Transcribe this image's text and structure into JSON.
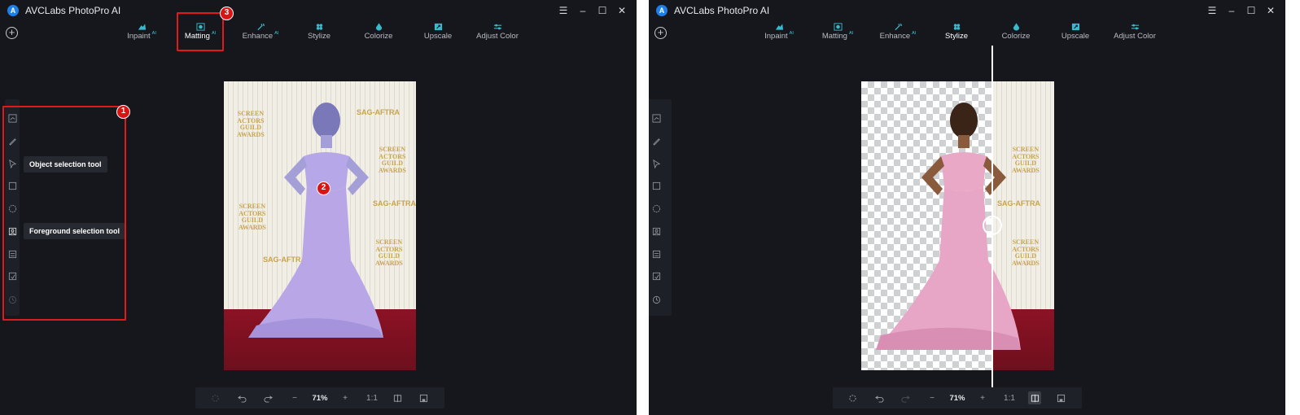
{
  "app": {
    "title": "AVCLabs PhotoPro AI",
    "logo_letter": "A"
  },
  "window_controls": {
    "menu": "☰",
    "minimize": "–",
    "maximize": "☐",
    "close": "✕"
  },
  "toolbar": {
    "add_label": "+",
    "ai_tag": "AI",
    "tabs": [
      {
        "label": "Inpaint",
        "ai": true,
        "icon": "inpaint-icon"
      },
      {
        "label": "Matting",
        "ai": true,
        "icon": "matting-icon"
      },
      {
        "label": "Enhance",
        "ai": true,
        "icon": "enhance-icon"
      },
      {
        "label": "Stylize",
        "ai": false,
        "icon": "stylize-icon"
      },
      {
        "label": "Colorize",
        "ai": false,
        "icon": "colorize-icon"
      },
      {
        "label": "Upscale",
        "ai": false,
        "icon": "upscale-icon"
      },
      {
        "label": "Adjust Color",
        "ai": false,
        "icon": "adjust-color-icon"
      }
    ]
  },
  "left_window": {
    "active_tab": "Matting"
  },
  "right_window": {
    "active_tab": "Stylize"
  },
  "sidebar": {
    "tools": [
      "brush-icon",
      "pen-icon",
      "object-selection-icon",
      "rectangle-select-icon",
      "ellipse-select-icon",
      "foreground-selection-icon",
      "layers-icon",
      "export-icon",
      "history-icon"
    ]
  },
  "tooltips": {
    "object_selection": "Object selection tool",
    "foreground_selection": "Foreground selection tool"
  },
  "photo_text": {
    "sag_aftra": "SAG-AFTRA",
    "screen": "SCREEN",
    "actors": "ACTORS",
    "guild": "GUILD",
    "awards": "AWARDS"
  },
  "bottom_bar": {
    "zoom_out": "−",
    "zoom": "71%",
    "zoom_in": "+",
    "actual": "1:1"
  },
  "annotations": {
    "badge1": "1",
    "badge2": "2",
    "badge3": "3"
  },
  "colors": {
    "accent": "#3cc5d6",
    "annotation_red": "#e01a1a",
    "background": "#15171c",
    "dress_left": "#b9a6e6",
    "dress_right": "#e8a6c6"
  }
}
